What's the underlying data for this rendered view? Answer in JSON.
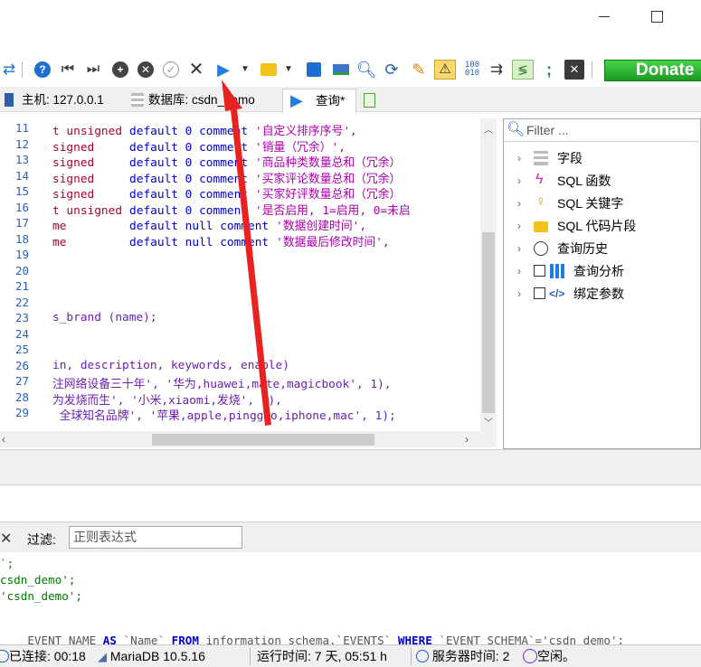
{
  "window": {
    "minimize_glyph": "—",
    "maximize_glyph": "☐"
  },
  "toolbar": {
    "icons": [
      "connect-arrows-icon",
      "help-icon",
      "first-record-icon",
      "last-record-icon",
      "add-record-icon",
      "delete-record-icon",
      "apply-icon",
      "cancel-icon",
      "run-query-icon",
      "dropdown-icon",
      "open-folder-icon",
      "dropdown-icon",
      "save-icon",
      "load-icon",
      "find-icon",
      "replace-icon",
      "clean-icon",
      "warning-icon",
      "binary-icon",
      "word-wrap-icon",
      "format-sql-icon",
      "semicolon-icon",
      "close-tab-icon"
    ],
    "donate_label": "Donate"
  },
  "tabs": [
    {
      "label": "主机: 127.0.0.1",
      "icon": "host-icon"
    },
    {
      "label": "数据库: csdn_demo",
      "icon": "database-icon"
    },
    {
      "label": "查询*",
      "icon": "query-icon"
    },
    {
      "label": "",
      "icon": "new-query-tab-icon"
    }
  ],
  "editor": {
    "line_numbers": [
      "11",
      "12",
      "13",
      "14",
      "15",
      "16",
      "17",
      "18",
      "19",
      "20",
      "21",
      "22",
      "23",
      "24",
      "25",
      "26",
      "27",
      "28",
      "29"
    ],
    "lines": [
      {
        "a": "t unsigned",
        "b": "default 0 comment",
        "c": "'自定义排序序号',",
        "color": "red"
      },
      {
        "a": "signed    ",
        "b": "default 0 comment",
        "c": "'销量（冗余）',",
        "color": "red"
      },
      {
        "a": "signed    ",
        "b": "default 0 comment",
        "c": "'商品种类数量总和（冗余）",
        "color": "red"
      },
      {
        "a": "signed    ",
        "b": "default 0 comment",
        "c": "'买家评论数量总和（冗余）",
        "color": "red"
      },
      {
        "a": "signed    ",
        "b": "default 0 comment",
        "c": "'买家好评数量总和（冗余）",
        "color": "red"
      },
      {
        "a": "t unsigned",
        "b": "default 0 comment",
        "c": "'是否启用, 1=启用, 0=未启",
        "color": "red"
      },
      {
        "a": "me        ",
        "b": "default null comment",
        "c": "'数据创建时间',",
        "color": "red"
      },
      {
        "a": "me        ",
        "b": "default null comment",
        "c": "'数据最后修改时间',",
        "color": "red"
      },
      {
        "a": "",
        "b": "",
        "c": ""
      },
      {
        "a": "",
        "b": "",
        "c": ""
      },
      {
        "a": "",
        "b": "",
        "c": ""
      },
      {
        "a": "",
        "b": "",
        "c": ""
      },
      {
        "a": "s_brand (name);",
        "b": "",
        "c": ""
      },
      {
        "a": "",
        "b": "",
        "c": ""
      },
      {
        "a": "",
        "b": "",
        "c": ""
      },
      {
        "a": "in, description, keywords, enable)",
        "b": "",
        "c": ""
      },
      {
        "a": "注网络设备三十年', '华为,huawei,mate,magicbook', 1),",
        "b": "",
        "c": ""
      },
      {
        "a": "为发烧而生', '小米,xiaomi,发烧', 1),",
        "b": "",
        "c": ""
      },
      {
        "a": " 全球知名品牌', '苹果,apple,pingguo,iphone,mac', 1);",
        "b": "",
        "c": ""
      }
    ]
  },
  "right_panel": {
    "filter_placeholder": "Filter ...",
    "items": [
      {
        "label": "字段",
        "icon": "fields-icon"
      },
      {
        "label": "SQL 函数",
        "icon": "function-icon"
      },
      {
        "label": "SQL 关键字",
        "icon": "key-icon"
      },
      {
        "label": "SQL 代码片段",
        "icon": "folder-icon"
      },
      {
        "label": "查询历史",
        "icon": "history-icon"
      },
      {
        "label": "查询分析",
        "icon": "chart-icon"
      },
      {
        "label": "绑定参数",
        "icon": "code-icon"
      }
    ]
  },
  "filterbar": {
    "close": "✕",
    "label": "过滤:",
    "placeholder": "正则表达式"
  },
  "log": {
    "line1": "`;",
    "line2": "csdn_demo';",
    "line3": "'csdn_demo';",
    "line5a": "EVENT_NAME",
    "line5b": "AS",
    "line5c": "`Name`",
    "line5d": "FROM",
    "line5e": "information_schema.`EVENTS`",
    "line5f": "WHERE",
    "line5g": "`EVENT_SCHEMA`='csdn_demo';"
  },
  "status": {
    "connected": "已连接: 00:18",
    "server": "MariaDB 10.5.16",
    "uptime": "运行时间: 7 天, 05:51 h",
    "server_time": "服务器时间: 2",
    "idle": "空闲。"
  },
  "colors": {
    "donate": "#2aa32e",
    "annotation_arrow": "#e8231f",
    "line_number": "#2a60b8",
    "keyword": "#0000cc",
    "string": "#aa00aa"
  }
}
